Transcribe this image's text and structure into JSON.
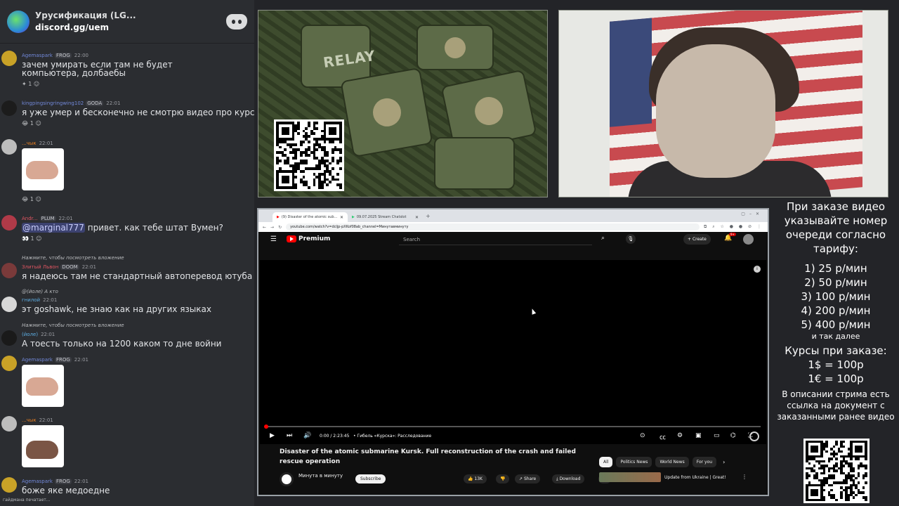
{
  "discord": {
    "server_name": "Урусификация (LG...",
    "server_link": "discord.gg/uem",
    "messages": [
      {
        "author": "Agemaspark",
        "tag": "FROG",
        "time": "22:00",
        "text": "зачем умирать если там не будет компьютера, долбаебы",
        "reactions": "1"
      },
      {
        "author": "kingpingsingringwing102",
        "tag": "GODA",
        "time": "22:01",
        "text": "я уже умер и бесконечно не смотрю видео про курск",
        "reactions": "1"
      },
      {
        "author": "...чык",
        "time": "22:01",
        "reactions": "1"
      },
      {
        "author": "Andr...",
        "tag": "PLUM",
        "time": "22:01",
        "text": "привет. как тебе штат Вумен?",
        "mention": "@marginal777",
        "reactions": "1"
      },
      {
        "reply": "Нажмите, чтобы посмотреть вложение",
        "author": "Злитый Львон",
        "tag": "DOOM",
        "time": "22:01",
        "text": "я надеюсь там не стандартный автоперевод ютуба"
      },
      {
        "reply": "@(йоле) А кто",
        "author": "гнилой",
        "time": "22:01",
        "text": "эт goshawk, не знаю как на других языках"
      },
      {
        "reply": "Нажмите, чтобы посмотреть вложение",
        "author": "(йоле)",
        "time": "22:01",
        "text": "А тоесть только на 1200 каком то дне войни"
      },
      {
        "author": "Agemaspark",
        "tag": "FROG",
        "time": "22:01"
      },
      {
        "author": "...чык",
        "time": "22:01"
      },
      {
        "author": "Agemaspark",
        "tag": "FROG",
        "time": "22:01",
        "text": "боже яке медоедне"
      }
    ],
    "typing": "гайдмана печатает..."
  },
  "relay": {
    "label": "RELAY"
  },
  "browser": {
    "tabs": [
      {
        "label": "(9) Disaster of the atomic sub...",
        "active": true
      },
      {
        "label": "09.07.2025 Stream Chatslot",
        "active": false
      }
    ],
    "url": "youtube.com/watch?v=dcljp-pXKof08ab_channel=Минутавминуту"
  },
  "youtube": {
    "logo_text": "Premium",
    "search_placeholder": "Search",
    "create_label": "Create",
    "bell_badge": "9+",
    "time": "0:00 / 2:23:45",
    "chapter": "• Гибель «Курска»: Расследование",
    "video_title": "Disaster of the atomic submarine Kursk. Full reconstruction of the crash and failed rescue operation",
    "channel_name": "Минута в минуту",
    "subscribe_label": "Subscribe",
    "like_count": "13K",
    "share_label": "Share",
    "download_label": "Download",
    "chips": [
      "All",
      "Politics News",
      "World News",
      "For you"
    ],
    "rec_title": "Update from Ukraine | Great!",
    "progress": 0
  },
  "panel": {
    "heading": "При заказе видео указывайте номер очереди согласно тарифу:",
    "tariffs": [
      "1) 25 р/мин",
      "2) 50 р/мин",
      "3) 100 р/мин",
      "4) 200 р/мин",
      "5) 400 р/мин"
    ],
    "etc": "и так далее",
    "rates_heading": "Курсы при заказе:",
    "rates": [
      "1$ = 100р",
      "1€ = 100р"
    ],
    "note": "В описании стрима есть ссылка на документ с заказанными ранее видео"
  }
}
